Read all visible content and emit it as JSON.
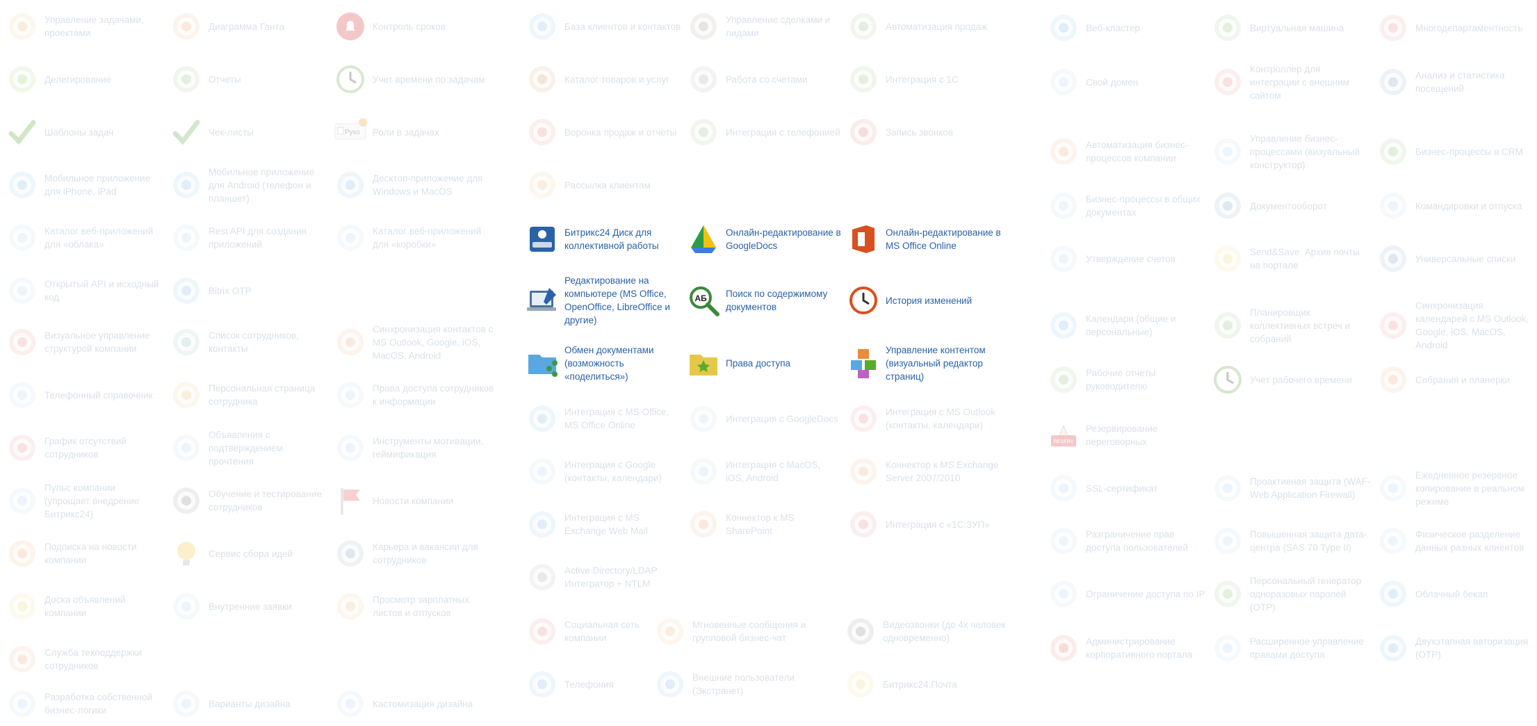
{
  "columns": {
    "tasks": [
      {
        "icon": "tasks-icon",
        "label": "Управление задачами, проектами",
        "color": "#e5a24a"
      },
      {
        "icon": "gantt-icon",
        "label": "Диаграмма Ганта",
        "color": "#e98c3c"
      },
      {
        "icon": "bell-icon",
        "label": "Контроль сроков",
        "color": "#d93b3b"
      },
      {
        "icon": "delegate-icon",
        "label": "Делегирование",
        "color": "#6cbf3a"
      },
      {
        "icon": "reports-gear-icon",
        "label": "Отчеты",
        "color": "#6aa84f"
      },
      {
        "icon": "clock-icon",
        "label": "Учет времени по задачам",
        "color": "#77b14a"
      },
      {
        "icon": "checkmark-icon",
        "label": "Шаблоны задач",
        "color": "#5aaa2e"
      },
      {
        "icon": "checklist-icon",
        "label": "Чек-листы",
        "color": "#6aa84f"
      },
      {
        "icon": "roles-tag-icon",
        "label": "Роли в задачах",
        "color": "#d28a1f",
        "tag": "Руководу"
      },
      {
        "icon": "mobile-app-icon",
        "label": "Мобильное приложение для iPhone, iPad",
        "color": "#4fa3d9"
      },
      {
        "icon": "android-app-icon",
        "label": "Мобильное приложение для Android (телефон и планшет)",
        "color": "#4fa3d9"
      },
      {
        "icon": "desktop-app-icon",
        "label": "Десктоп-приложение для Windows и MacOS",
        "color": "#4fa3d9"
      },
      {
        "icon": "cloud-apps-icon",
        "label": "Каталог веб-приложений для «облака»",
        "color": "#9cc4e8"
      },
      {
        "icon": "rest-api-icon",
        "label": "Rest API для создания приложений",
        "color": "#9cc4e8"
      },
      {
        "icon": "box-apps-icon",
        "label": "Каталог веб-приложений для «коробки»",
        "color": "#9cc4e8"
      },
      {
        "icon": "open-api-icon",
        "label": "Открытый API и исходный код",
        "color": "#9cc4e8"
      },
      {
        "icon": "bitrix-otp-icon",
        "label": "Bitrix OTP",
        "color": "#4fa3d9"
      },
      {
        "icon": "structure-icon",
        "label": "Визуальное управление структурой компании",
        "color": "#e55a5a"
      },
      {
        "icon": "employee-list-icon",
        "label": "Список сотрудников, контакты",
        "color": "#5aaa9a"
      },
      {
        "icon": "sync-contacts-icon",
        "label": "Синхронизация контактов с MS Outlook, Google, iOS, MacOS, Android",
        "color": "#e98c3c"
      },
      {
        "icon": "phonebook-icon",
        "label": "Телефонный справочник",
        "color": "#9cc4e8"
      },
      {
        "icon": "personal-page-icon",
        "label": "Персональная страница сотрудника",
        "color": "#e5a24a"
      },
      {
        "icon": "access-rights-icon",
        "label": "Права доступа сотрудников к информации",
        "color": "#9cc4e8"
      },
      {
        "icon": "absence-chart-icon",
        "label": "График отсутствий сотрудников",
        "color": "#e55a5a"
      },
      {
        "icon": "announcements-icon",
        "label": "Объявления с подтверждением прочтения",
        "color": "#9cc4e8"
      },
      {
        "icon": "motivation-icon",
        "label": "Инструменты мотивации, геймификация",
        "color": "#9cc4e8"
      },
      {
        "icon": "pulse-icon",
        "label": "Пульс компании (упрощает внедрение Битрикс24)",
        "color": "#9cc4e8"
      },
      {
        "icon": "training-icon",
        "label": "Обучение и тестирование сотрудников",
        "color": "#555555"
      },
      {
        "icon": "news-flag-icon",
        "label": "Новости компании",
        "color": "#e55a5a"
      },
      {
        "icon": "rss-icon",
        "label": "Подписка на новости компании",
        "color": "#e98c3c"
      },
      {
        "icon": "idea-bulb-icon",
        "label": "Сервис сбора идей",
        "color": "#f2c94c"
      },
      {
        "icon": "career-icon",
        "label": "Карьера и вакансии для сотрудников",
        "color": "#4f7fb3"
      },
      {
        "icon": "board-icon",
        "label": "Доска объявлений компании",
        "color": "#e5c84a"
      },
      {
        "icon": "requests-icon",
        "label": "Внутренние заявки",
        "color": "#9cc4e8"
      },
      {
        "icon": "payslip-icon",
        "label": "Просмотр зарплатных листов и отпусков",
        "color": "#e5a24a"
      },
      {
        "icon": "support-icon",
        "label": "Служба техподдержки сотрудников",
        "color": "#e98c3c"
      },
      {
        "icon": "custom-logic-icon",
        "label": "Разработка собственной бизнес-логики",
        "color": "#9cc4e8"
      },
      {
        "icon": "design-variants-icon",
        "label": "Варианты дизайна",
        "color": "#9cc4e8"
      },
      {
        "icon": "customization-icon",
        "label": "Кастомизация дизайна",
        "color": "#9cc4e8"
      }
    ],
    "crm": [
      {
        "icon": "clients-base-icon",
        "label": "База клиентов и контактов",
        "color": "#4fa3d9"
      },
      {
        "icon": "deals-icon",
        "label": "Управление сделками и лидами",
        "color": "#7a6a5a"
      },
      {
        "icon": "sales-automation-icon",
        "label": "Автоматизация продаж",
        "color": "#6aa84f"
      },
      {
        "icon": "catalog-icon",
        "label": "Каталог товаров и услуг",
        "color": "#c96a2a"
      },
      {
        "icon": "invoices-icon",
        "label": "Работа со счетами",
        "color": "#888888"
      },
      {
        "icon": "1c-integration-icon",
        "label": "Интеграция с 1С",
        "color": "#6aa84f"
      },
      {
        "icon": "funnel-icon",
        "label": "Воронка продаж и отчеты",
        "color": "#e55a3a"
      },
      {
        "icon": "telephony-integration-icon",
        "label": "Интеграция с телефонией",
        "color": "#6aa84f"
      },
      {
        "icon": "call-record-icon",
        "label": "Запись звонков",
        "color": "#d93b3b"
      },
      {
        "icon": "mailing-icon",
        "label": "Рассылка клиентам",
        "color": "#e5a24a"
      }
    ],
    "disk": [
      {
        "icon": "disk-drive-icon",
        "label": "Битрикс24 Диск для коллективной работы",
        "color": "#2a62a8"
      },
      {
        "icon": "googledocs-edit-icon",
        "label": "Онлайн-редактирование в GoogleDocs",
        "color": "#3a8a3a"
      },
      {
        "icon": "ms-office-edit-icon",
        "label": "Онлайн-редактирование в MS Office Online",
        "color": "#d8501e"
      },
      {
        "icon": "desktop-edit-icon",
        "label": "Редактирование на компьютере (MS Office, OpenOffice, LibreOffice и другие)",
        "color": "#4f7fb3"
      },
      {
        "icon": "content-search-icon",
        "label": "Поиск по содержимому документов",
        "color": "#3a8a3a"
      },
      {
        "icon": "history-icon",
        "label": "История изменений",
        "color": "#d8501e"
      },
      {
        "icon": "share-docs-icon",
        "label": "Обмен документами (возможность «поделиться»)",
        "color": "#4fa3d9"
      },
      {
        "icon": "permissions-folder-icon",
        "label": "Права доступа",
        "color": "#e5c84a"
      },
      {
        "icon": "content-blocks-icon",
        "label": "Управление контентом (визуальный редактор страниц)",
        "color": "#e98c3c"
      },
      {
        "icon": "ms-office-integration-icon",
        "label": "Интеграция с MS Office, MS Office Online",
        "color": "#4fa3d9"
      },
      {
        "icon": "googledocs-integration-icon",
        "label": "Интеграция с GoogleDocs",
        "color": "#9cc4e8"
      },
      {
        "icon": "outlook-integration-icon",
        "label": "Интеграция с MS Outlook (контакты, календари)",
        "color": "#e55a5a"
      },
      {
        "icon": "google-integration-icon",
        "label": "Интеграция с Google (контакты, календари)",
        "color": "#9cc4e8"
      },
      {
        "icon": "macos-integration-icon",
        "label": "Интеграция с MacOS, iOS, Android",
        "color": "#9cc4e8"
      },
      {
        "icon": "exchange-connector-icon",
        "label": "Коннектор к MS Exchange Server 2007/2010",
        "color": "#e98c3c"
      },
      {
        "icon": "exchange-webmail-icon",
        "label": "Интеграция с MS Exchange Web Mail",
        "color": "#4fa3d9"
      },
      {
        "icon": "sharepoint-icon",
        "label": "Коннектор к MS SharePoint",
        "color": "#e98c3c"
      },
      {
        "icon": "1c-zup-icon",
        "label": "Интеграция с «1С:ЗУП»",
        "color": "#e55a5a"
      },
      {
        "icon": "active-directory-icon",
        "label": "Active Directory/LDAP Интегратор + NTLM",
        "color": "#888888"
      },
      {
        "icon": "social-network-icon",
        "label": "Социальная сеть компании",
        "color": "#e55a5a"
      },
      {
        "icon": "chat-icon",
        "label": "Мгновенные сообщения и групповой бизнес-чат",
        "color": "#e5a24a"
      },
      {
        "icon": "video-call-icon",
        "label": "Видеозвонки (до 4х человек одновременно)",
        "color": "#555555"
      },
      {
        "icon": "telephony-icon",
        "label": "Телефония",
        "color": "#4fa3d9"
      },
      {
        "icon": "extranet-icon",
        "label": "Внешние пользователи (Экстранет)",
        "color": "#4fa3d9"
      },
      {
        "icon": "mail-icon",
        "label": "Битрикс24.Почта",
        "color": "#e5c84a"
      }
    ],
    "infra": [
      {
        "icon": "web-cluster-icon",
        "label": "Веб-кластер",
        "color": "#4fa3d9"
      },
      {
        "icon": "virtual-machine-icon",
        "label": "Виртуальная машина",
        "color": "#6aa84f"
      },
      {
        "icon": "multidepartment-icon",
        "label": "Многодепартаментность",
        "color": "#e55a5a"
      },
      {
        "icon": "own-domain-icon",
        "label": "Свой домен",
        "color": "#9cc4e8"
      },
      {
        "icon": "controller-icon",
        "label": "Контроллер для интеграции с внешним сайтом",
        "color": "#e55a5a"
      },
      {
        "icon": "visit-stats-icon",
        "label": "Анализ и статистика посещений",
        "color": "#4f7fb3"
      },
      {
        "icon": "bp-automation-icon",
        "label": "Автоматизация бизнес-процессов компании",
        "color": "#e98c3c"
      },
      {
        "icon": "bp-visual-icon",
        "label": "Управление бизнес-процессами (визуальный конструктор)",
        "color": "#9cc4e8"
      },
      {
        "icon": "bp-crm-icon",
        "label": "Бизнес-процессы в CRM",
        "color": "#6aa84f"
      },
      {
        "icon": "bp-docs-icon",
        "label": "Бизнес-процессы в общих документах",
        "color": "#9cc4e8"
      },
      {
        "icon": "doc-flow-icon",
        "label": "Документооборот",
        "color": "#4f7fb3"
      },
      {
        "icon": "trips-icon",
        "label": "Командировки и отпуска",
        "color": "#9cc4e8"
      },
      {
        "icon": "invoice-approval-icon",
        "label": "Утверждение счетов",
        "color": "#9cc4e8"
      },
      {
        "icon": "send-save-icon",
        "label": "Send&Save. Архив почты на портале",
        "color": "#e5c84a"
      },
      {
        "icon": "universal-lists-icon",
        "label": "Универсальные списки",
        "color": "#4f7fb3"
      },
      {
        "icon": "calendars-icon",
        "label": "Календари (общие и персональные)",
        "color": "#4fa3d9"
      },
      {
        "icon": "meeting-planner-icon",
        "label": "Планировщик коллективных встреч и собраний",
        "color": "#6aa84f"
      },
      {
        "icon": "calendar-sync-icon",
        "label": "Синхронизация календарей с MS Outlook, Google, iOS, MacOS, Android",
        "color": "#e55a5a"
      },
      {
        "icon": "work-reports-icon",
        "label": "Рабочие отчеты руководителю",
        "color": "#6aa84f"
      },
      {
        "icon": "time-tracking-icon",
        "label": "Учет рабочего времени",
        "color": "#6aa84f"
      },
      {
        "icon": "meetings-icon",
        "label": "Собрания и планерки",
        "color": "#e98c3c"
      },
      {
        "icon": "room-booking-icon",
        "label": "Резервирование переговорных",
        "color": "#d93b3b",
        "tag": "RESERVED"
      },
      {
        "icon": "ssl-icon",
        "label": "SSL-сертификат",
        "color": "#9cc4e8"
      },
      {
        "icon": "waf-icon",
        "label": "Проактивная защита (WAF-Web Application Firewall)",
        "color": "#9cc4e8"
      },
      {
        "icon": "backup-icon",
        "label": "Ежедневное резервное копирование в реальном режиме",
        "color": "#9cc4e8"
      },
      {
        "icon": "access-separation-icon",
        "label": "Разграничение прав доступа пользователей",
        "color": "#9cc4e8"
      },
      {
        "icon": "dc-security-icon",
        "label": "Повышенная защита дата-центра (SAS 70 Type II)",
        "color": "#9cc4e8"
      },
      {
        "icon": "physical-separation-icon",
        "label": "Физическое разделение данных разных клиентов",
        "color": "#9cc4e8"
      },
      {
        "icon": "ip-restrict-icon",
        "label": "Ограничение доступа по IP",
        "color": "#9cc4e8"
      },
      {
        "icon": "otp-generator-icon",
        "label": "Персональный генератор одноразовых паролей (OTP)",
        "color": "#6aa84f"
      },
      {
        "icon": "cloud-backup-icon",
        "label": "Облачный бекап",
        "color": "#4fa3d9"
      },
      {
        "icon": "admin-portal-icon",
        "label": "Администрирование корпоративного портала",
        "color": "#d93b3b"
      },
      {
        "icon": "extended-rights-icon",
        "label": "Расширенное управление правами доступа",
        "color": "#9cc4e8"
      },
      {
        "icon": "two-factor-icon",
        "label": "Двухэтапная авторизация (OTP)",
        "color": "#4fa3d9"
      }
    ]
  }
}
